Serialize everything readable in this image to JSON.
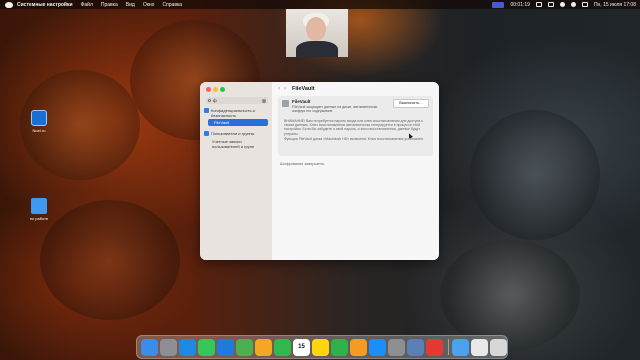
{
  "menubar": {
    "app_name": "Системные настройки",
    "menus": [
      "Файл",
      "Правка",
      "Вид",
      "Окно",
      "Справка"
    ],
    "timer": "00:01:19",
    "datetime": "Пн, 15 июля 17:08"
  },
  "desktop_icons": [
    {
      "label": "Noel.ru",
      "icon": "app-icon"
    },
    {
      "label": "по работе",
      "icon": "folder-icon"
    }
  ],
  "window": {
    "search_value": "ф",
    "sidebar": {
      "section1_label": "Конфиденциальность и безопасность",
      "selected_item": "FileVault",
      "section2_label": "Пользователи и группы",
      "section2_sub": "Учетные записи пользователей и групп"
    },
    "title": "FileVault",
    "filevault": {
      "name": "FileVault",
      "description": "FileVault защищает данные на диске, автоматически шифруя его содержимое.",
      "button_label": "Выключить…",
      "warning": "ВНИМАНИЕ! Вам потребуется пароль входа или ключ восстановления для доступа к своим данным. Ключ восстановления автоматически генерируется в процессе этой настройки. Если Вы забудете и свой пароль, и ключ восстановления, данные будут утеряны.",
      "info": "Функция FileVault диска «Macintosh HD» включена. Ключ восстановления установлен."
    },
    "status": "Шифрование завершено."
  },
  "dock": {
    "apps": [
      {
        "name": "finder-icon",
        "color": "#3a8de8"
      },
      {
        "name": "launchpad-icon",
        "color": "#8e8e93"
      },
      {
        "name": "safari-icon",
        "color": "#1e88e5"
      },
      {
        "name": "messages-icon",
        "color": "#34c759"
      },
      {
        "name": "mail-icon",
        "color": "#1f7ae0"
      },
      {
        "name": "maps-icon",
        "color": "#4caf50"
      },
      {
        "name": "photos-icon",
        "color": "#f5a623"
      },
      {
        "name": "facetime-icon",
        "color": "#30b94d"
      },
      {
        "name": "calendar-icon",
        "color": "#ffffff"
      },
      {
        "name": "notes-icon",
        "color": "#ffd60a"
      },
      {
        "name": "numbers-icon",
        "color": "#2fb24c"
      },
      {
        "name": "pages-icon",
        "color": "#f59a23"
      },
      {
        "name": "appstore-icon",
        "color": "#1c8ef9"
      },
      {
        "name": "settings-icon",
        "color": "#8e8e93"
      },
      {
        "name": "preview-icon",
        "color": "#5a7fb5"
      },
      {
        "name": "screen-recorder-icon",
        "color": "#e53935"
      },
      {
        "name": "downloads-folder-icon",
        "color": "#4aa3f0"
      },
      {
        "name": "document-icon",
        "color": "#e8e8e8"
      },
      {
        "name": "trash-icon",
        "color": "#d7d7d7"
      }
    ],
    "calendar_day": "15"
  }
}
